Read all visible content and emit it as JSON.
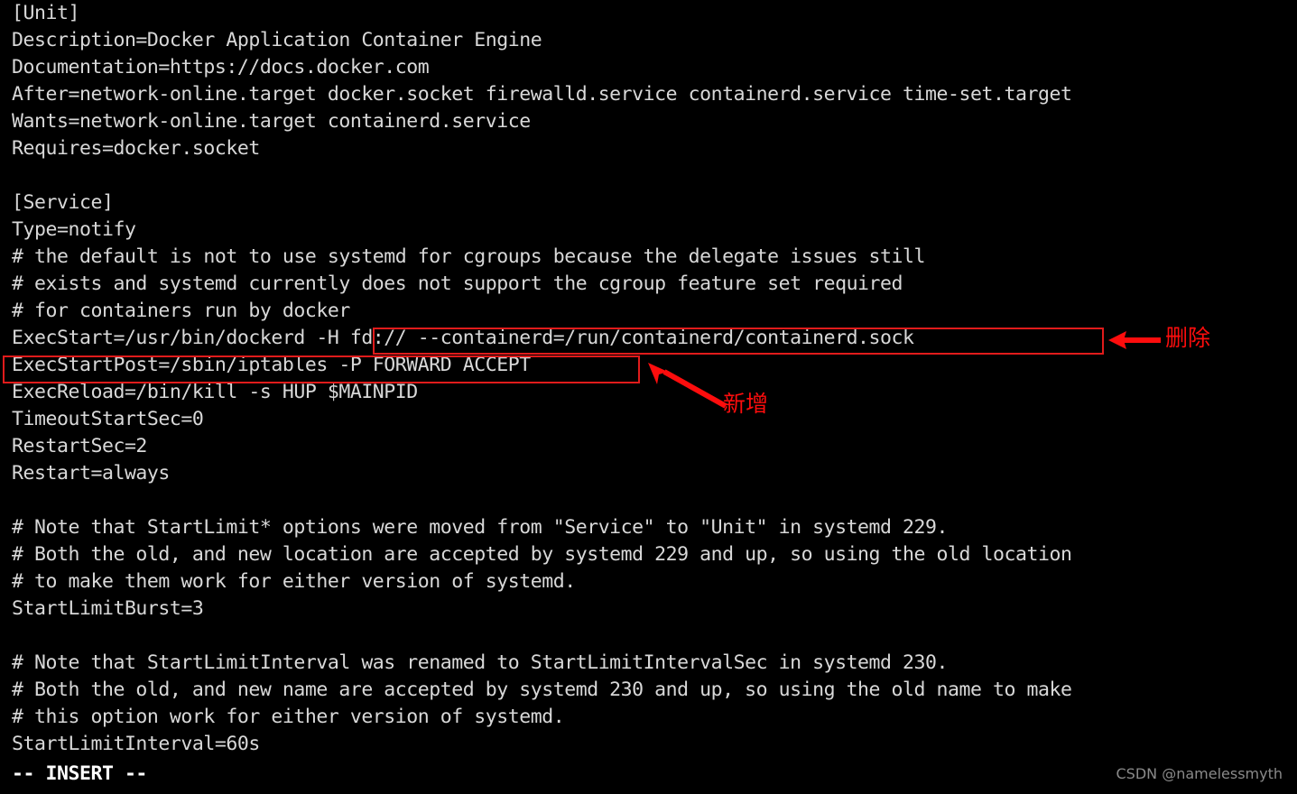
{
  "editor": {
    "mode_line": "-- INSERT --",
    "watermark": "CSDN @namelessmyth",
    "background_color": "#000000",
    "text_color": "#d8d8d8",
    "annotation_color": "#fd0d0d",
    "lines": [
      "[Unit]",
      "Description=Docker Application Container Engine",
      "Documentation=https://docs.docker.com",
      "After=network-online.target docker.socket firewalld.service containerd.service time-set.target",
      "Wants=network-online.target containerd.service",
      "Requires=docker.socket",
      "",
      "[Service]",
      "Type=notify",
      "# the default is not to use systemd for cgroups because the delegate issues still",
      "# exists and systemd currently does not support the cgroup feature set required",
      "# for containers run by docker",
      "ExecStart=/usr/bin/dockerd -H fd:// --containerd=/run/containerd/containerd.sock",
      "ExecStartPost=/sbin/iptables -P FORWARD ACCEPT",
      "ExecReload=/bin/kill -s HUP $MAINPID",
      "TimeoutStartSec=0",
      "RestartSec=2",
      "Restart=always",
      "",
      "# Note that StartLimit* options were moved from \"Service\" to \"Unit\" in systemd 229.",
      "# Both the old, and new location are accepted by systemd 229 and up, so using the old location",
      "# to make them work for either version of systemd.",
      "StartLimitBurst=3",
      "",
      "# Note that StartLimitInterval was renamed to StartLimitIntervalSec in systemd 230.",
      "# Both the old, and new name are accepted by systemd 230 and up, so using the old name to make",
      "# this option work for either version of systemd.",
      "StartLimitInterval=60s"
    ]
  },
  "annotations": [
    {
      "id": "delete",
      "label": "删除",
      "meaning": "delete",
      "target_line": "ExecStart=/usr/bin/dockerd -H fd:// --containerd=/run/containerd/containerd.sock",
      "target_fragment": "-H fd:// --containerd=/run/containerd/containerd.sock"
    },
    {
      "id": "add",
      "label": "新增",
      "meaning": "add",
      "target_line": "ExecStartPost=/sbin/iptables -P FORWARD ACCEPT",
      "target_fragment": "ExecStartPost=/sbin/iptables -P FORWARD ACCEPT"
    }
  ]
}
